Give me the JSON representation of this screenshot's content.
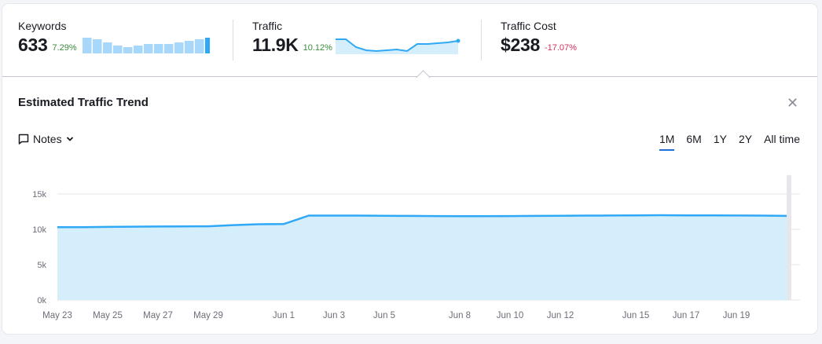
{
  "metrics": {
    "keywords": {
      "label": "Keywords",
      "value": "633",
      "change": "7.29%",
      "spark": [
        20,
        19,
        17,
        15,
        14,
        15,
        16,
        16,
        16,
        17,
        18,
        19,
        20
      ]
    },
    "traffic": {
      "label": "Traffic",
      "value": "11.9K",
      "change": "10.12%",
      "spark": [
        10.7,
        10.7,
        9.7,
        9.3,
        9.2,
        9.3,
        9.4,
        9.2,
        10.1,
        10.1,
        10.2,
        10.3,
        10.5
      ]
    },
    "traffic_cost": {
      "label": "Traffic Cost",
      "value": "$238",
      "change": "-17.07%"
    }
  },
  "panel": {
    "title": "Estimated Traffic Trend",
    "close_icon": "close-icon",
    "notes_label": "Notes",
    "periods": [
      "1M",
      "6M",
      "1Y",
      "2Y",
      "All time"
    ],
    "active_period": "1M"
  },
  "colors": {
    "line": "#2fa8f5",
    "area": "#d5eefc",
    "up": "#3a8a3d",
    "down": "#d1315c",
    "bars": "#a7d8fb",
    "bar_last": "#2fa8f5"
  },
  "chart_data": {
    "type": "area",
    "x": [
      "May 23",
      "May 24",
      "May 25",
      "May 26",
      "May 27",
      "May 28",
      "May 29",
      "May 30",
      "May 31",
      "Jun 1",
      "Jun 2",
      "Jun 3",
      "Jun 4",
      "Jun 5",
      "Jun 6",
      "Jun 7",
      "Jun 8",
      "Jun 9",
      "Jun 10",
      "Jun 11",
      "Jun 12",
      "Jun 13",
      "Jun 14",
      "Jun 15",
      "Jun 16",
      "Jun 17",
      "Jun 18",
      "Jun 19",
      "Jun 20",
      "Jun 21"
    ],
    "y": [
      10300,
      10300,
      10350,
      10380,
      10400,
      10420,
      10430,
      10600,
      10720,
      10750,
      11950,
      11950,
      11950,
      11920,
      11900,
      11880,
      11870,
      11850,
      11880,
      11900,
      11910,
      11940,
      11960,
      11980,
      12000,
      11980,
      11970,
      11960,
      11950,
      11900
    ],
    "x_ticks": [
      "May 23",
      "May 25",
      "May 27",
      "May 29",
      "Jun 1",
      "Jun 3",
      "Jun 5",
      "Jun 8",
      "Jun 10",
      "Jun 12",
      "Jun 15",
      "Jun 17",
      "Jun 19"
    ],
    "y_ticks": [
      "0k",
      "5k",
      "10k",
      "15k"
    ],
    "ylim": [
      0,
      15000
    ],
    "grid": true
  }
}
